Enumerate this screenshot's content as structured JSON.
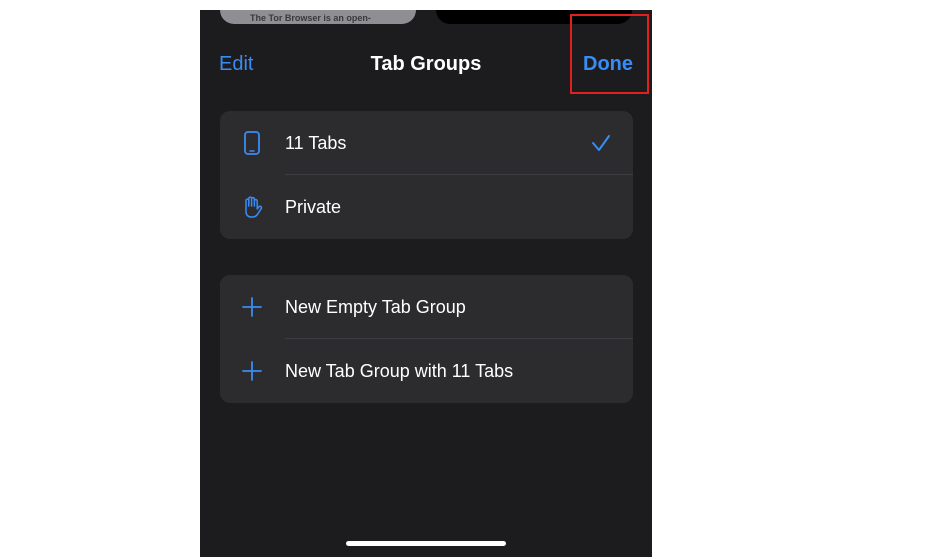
{
  "background_thumbnails": {
    "left_text": "The Tor Browser is an open-"
  },
  "nav": {
    "edit_label": "Edit",
    "title": "Tab Groups",
    "done_label": "Done"
  },
  "tab_groups": [
    {
      "label": "11 Tabs",
      "icon": "iphone-icon",
      "selected": true
    },
    {
      "label": "Private",
      "icon": "hand-raised-icon",
      "selected": false
    }
  ],
  "actions": [
    {
      "label": "New Empty Tab Group",
      "icon": "plus-icon"
    },
    {
      "label": "New Tab Group with 11 Tabs",
      "icon": "plus-icon"
    }
  ],
  "colors": {
    "accent": "#3a8cf5",
    "background": "#1c1c1e",
    "cell": "#2c2c2e",
    "highlight": "#e0201e"
  }
}
